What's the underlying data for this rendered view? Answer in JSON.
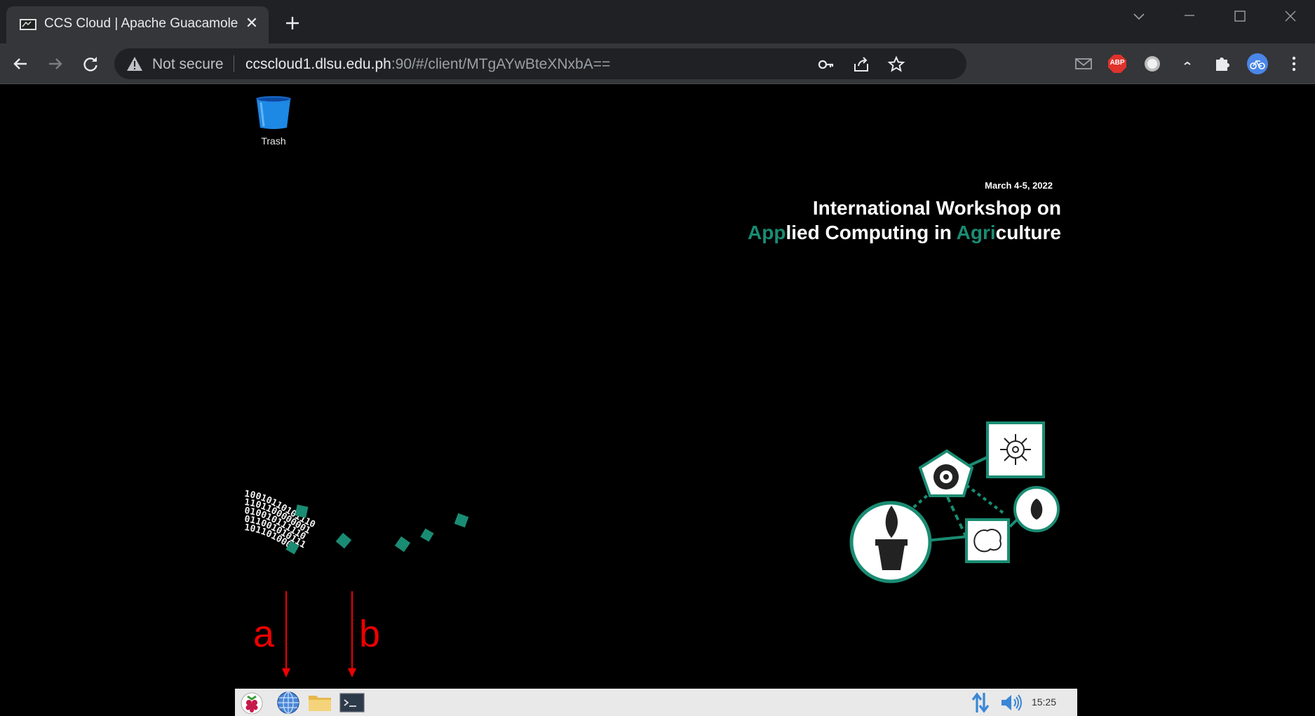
{
  "browser": {
    "tab": {
      "title": "CCS Cloud | Apache Guacamole",
      "close_glyph": "✕"
    },
    "security_label": "Not secure",
    "url": {
      "host": "ccscloud1.dlsu.edu.ph",
      "path": ":90/#/client/MTgAYwBteXNxbA=="
    },
    "extensions": [
      "mail-icon",
      "adblock-icon",
      "record-icon",
      "collapse-icon",
      "puzzle-icon",
      "profile-icon"
    ],
    "adblock_badge": "ABP"
  },
  "desktop": {
    "trash_label": "Trash",
    "event": {
      "date": "March 4-5, 2022",
      "title_line1": "International Workshop on",
      "title_line2": {
        "teal1": "App",
        "w1": "lied Computing in ",
        "teal2": "Agri",
        "w2": "culture"
      }
    },
    "binary_rows": [
      "10010110101110",
      "1101100000001",
      "010010111110",
      "011001010111",
      "101101000"
    ],
    "annotations": {
      "a": "a",
      "b": "b"
    }
  },
  "taskbar": {
    "items": [
      "raspberry-menu-icon",
      "web-browser-icon",
      "file-manager-icon",
      "terminal-icon"
    ],
    "clock": "15:25"
  },
  "colors": {
    "teal": "#1a8c73",
    "annotation": "#ee0000",
    "chrome_dark": "#202124",
    "chrome_toolbar": "#35363a"
  }
}
